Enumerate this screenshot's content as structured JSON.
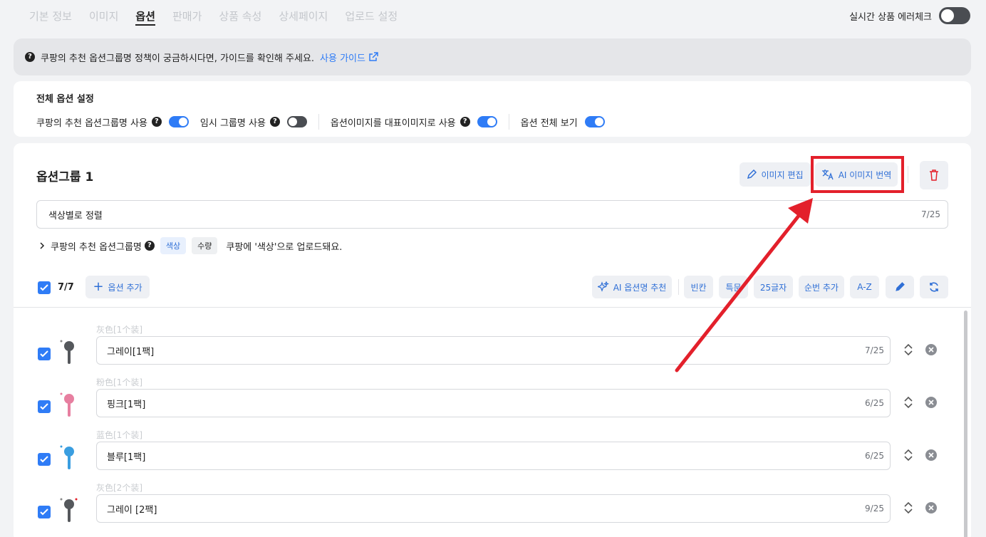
{
  "tabs": [
    "기본 정보",
    "이미지",
    "옵션",
    "판매가",
    "상품 속성",
    "상세페이지",
    "업로드 설정"
  ],
  "active_tab": "옵션",
  "error_check_label": "실시간 상품 에러체크",
  "info": {
    "text": "쿠팡의 추천 옵션그룹명 정책이 궁금하시다면, 가이드를 확인해 주세요.",
    "link": "사용 가이드"
  },
  "global": {
    "title": "전체 옵션 설정",
    "settings": [
      {
        "label": "쿠팡의 추천 옵션그룹명 사용",
        "help": true,
        "on": true
      },
      {
        "label": "임시 그룹명 사용",
        "help": true,
        "on": false
      },
      {
        "label": "옵션이미지를 대표이미지로 사용",
        "help": true,
        "on": true
      },
      {
        "label": "옵션 전체 보기",
        "help": false,
        "on": true
      }
    ]
  },
  "group": {
    "title": "옵션그룹 1",
    "edit_image": "이미지 편집",
    "ai_translate": "AI 이미지 번역",
    "name": "색상별로 정렬",
    "name_count": "7/25",
    "recommend_label": "쿠팡의 추천 옵션그룹명",
    "recommend_chips": [
      "색상",
      "수량"
    ],
    "recommend_note": "쿠팡에 '색상'으로 업로드돼요.",
    "selected_count": "7/7",
    "add_option": "옵션 추가",
    "ai_name": "AI 옵션명 추천",
    "tools": [
      "빈칸",
      "특문",
      "25글자",
      "순번 추가",
      "A-Z"
    ]
  },
  "options": [
    {
      "original": "灰色[1个装]",
      "value": "그레이[1팩]",
      "count": "7/25",
      "color": "#55585c"
    },
    {
      "original": "粉色[1个装]",
      "value": "핑크[1팩]",
      "count": "6/25",
      "color": "#e77fa0"
    },
    {
      "original": "蓝色[1个装]",
      "value": "블루[1팩]",
      "count": "6/25",
      "color": "#3a9ee0"
    },
    {
      "original": "灰色[2个装]",
      "value": "그레이 [2팩]",
      "count": "9/25",
      "color": "#55585c"
    }
  ],
  "colors": {
    "accent": "#2f7cf6",
    "highlight": "#e3202b"
  }
}
